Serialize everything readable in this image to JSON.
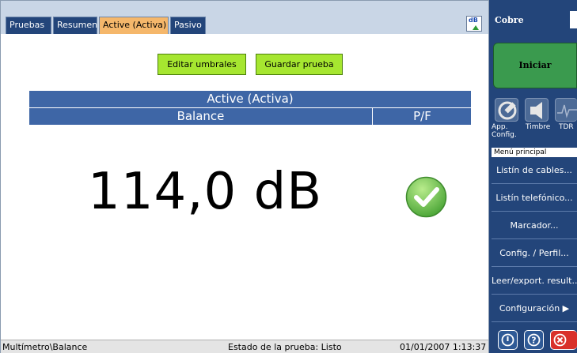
{
  "tabs": [
    {
      "label": "Pruebas",
      "active": false
    },
    {
      "label": "Resumen",
      "active": false
    },
    {
      "label": "Active (Activa)",
      "active": true
    },
    {
      "label": "Pasivo",
      "active": false
    }
  ],
  "toolbar": {
    "edit_thresholds": "Editar umbrales",
    "save_test": "Guardar prueba",
    "db_icon_text": "dB"
  },
  "table": {
    "title": "Active (Activa)",
    "col_balance": "Balance",
    "col_pf": "P/F"
  },
  "result": {
    "value": "114,0 dB",
    "pass": true
  },
  "status": {
    "path": "Multímetro\\Balance",
    "state": "Estado de la prueba: Listo",
    "datetime": "01/01/2007 1:13:37"
  },
  "side": {
    "title": "Cobre",
    "start": "Iniciar",
    "apps": [
      {
        "label": "App. Config.",
        "icon": "wrench-icon"
      },
      {
        "label": "Timbre",
        "icon": "speaker-icon"
      },
      {
        "label": "TDR",
        "icon": "waveform-icon"
      }
    ],
    "menu_title": "Menú principal",
    "menu": [
      "Listín de cables...",
      "Listín telefónico...",
      "Marcador...",
      "Config. / Perfil...",
      "Leer/export. result...",
      "Configuración ▶"
    ]
  },
  "colors": {
    "header_blue": "#3e66a6",
    "side_blue": "#23457a",
    "active_tab": "#f5b76b",
    "action_green": "#a6e630",
    "start_green": "#3a9a4e",
    "pass_green": "#6cc24a",
    "close_red": "#d9302a"
  }
}
